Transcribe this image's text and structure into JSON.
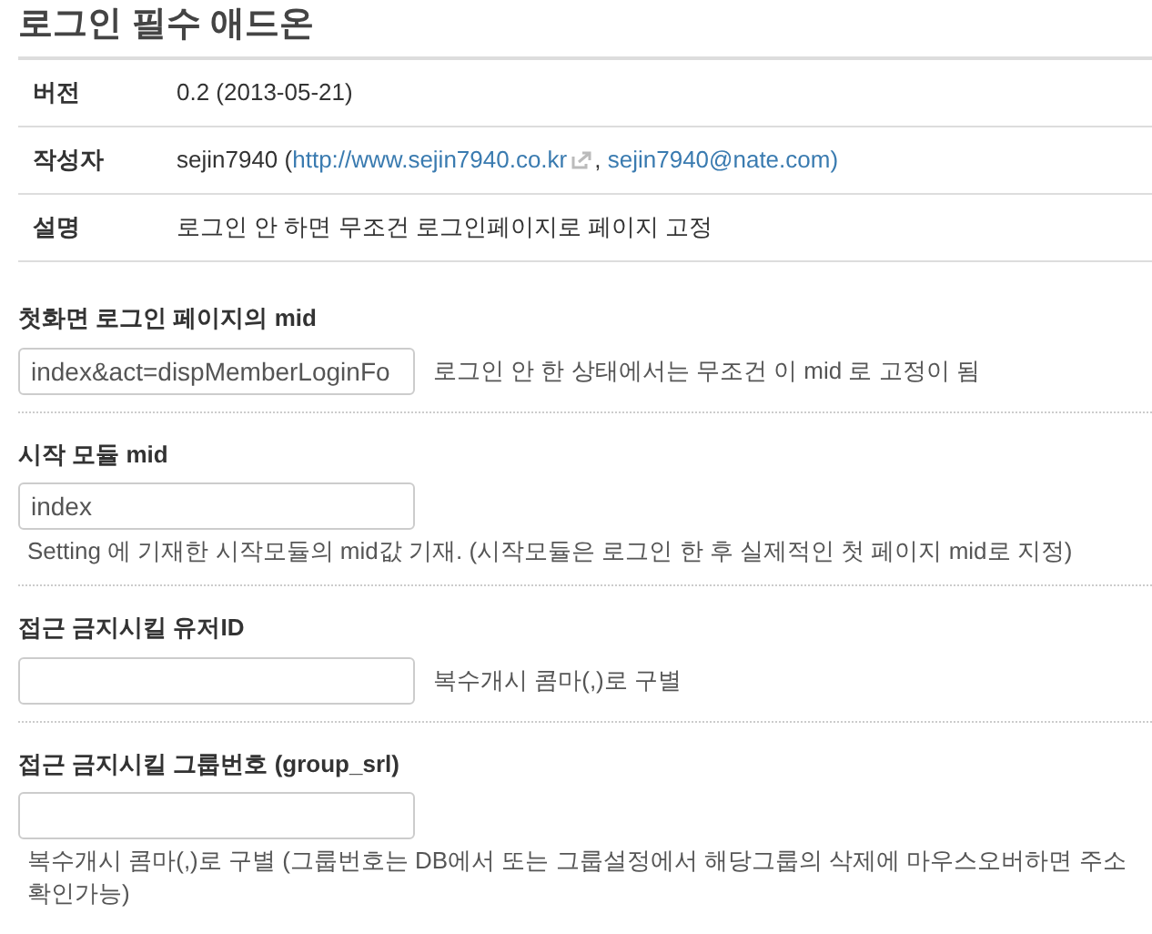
{
  "title": "로그인 필수 애드온",
  "info": [
    {
      "kind": "text",
      "label": "버전",
      "value": "0.2 (2013-05-21)"
    },
    {
      "kind": "author",
      "label": "작성자",
      "name": "sejin7940",
      "open": " (",
      "link": "http://www.sejin7940.co.kr",
      "sep": ", ",
      "email": "sejin7940@nate.com",
      "close": ")"
    },
    {
      "kind": "text",
      "label": "설명",
      "value": "로그인 안 하면 무조건 로그인페이지로 페이지 고정"
    }
  ],
  "fields": [
    {
      "kind": "inline",
      "label": "첫화면 로그인 페이지의 mid",
      "value": "index&act=dispMemberLoginFo",
      "help": [
        "로그인 안 한 상태에서는 무조건 이 mid 로 고정이 됨"
      ]
    },
    {
      "kind": "below",
      "label": "시작 모듈 mid",
      "value": "index",
      "help": [
        "Setting 에 기재한 시작모듈의 mid값 기재. (시작모듈은 로그인 한 후 실제적인 첫 페이지 mid로 지정)"
      ]
    },
    {
      "kind": "inline",
      "label": "접근 금지시킬 유저ID",
      "help": [
        "복수개시 콤마(,)로 구별"
      ]
    },
    {
      "kind": "below",
      "label": "접근 금지시킬 그룹번호 (group_srl)",
      "help": [
        "복수개시 콤마(,)로 구별 (그룹번호는 DB에서 또는 그룹설정에서 해당그룹의 삭제에 마우스오버하면 주소",
        "확인가능)"
      ]
    }
  ]
}
